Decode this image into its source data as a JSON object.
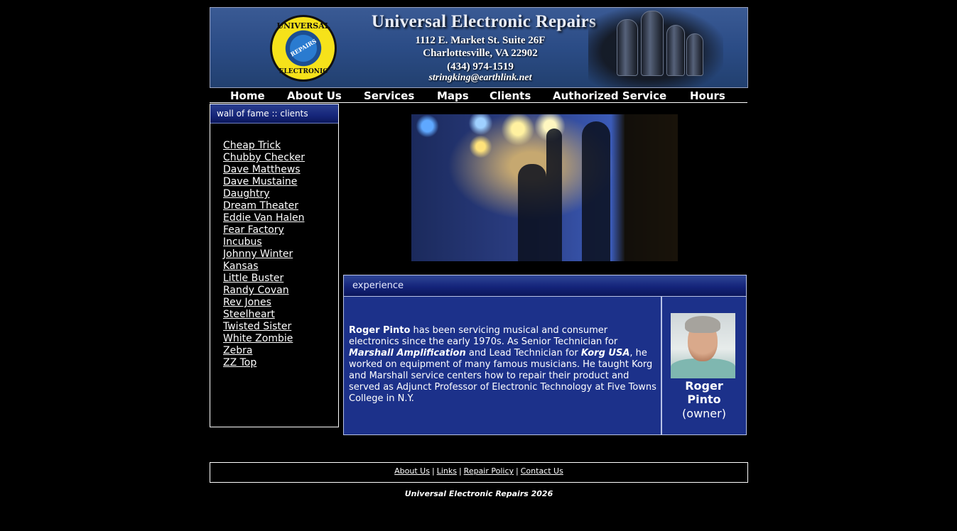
{
  "header": {
    "company_name": "Universal Electronic Repairs",
    "address_line1": "1112 E. Market St. Suite 26F",
    "address_line2": "Charlottesville, VA  22902",
    "phone": "(434) 974-1519",
    "email": "stringking@earthlink.net",
    "logo_text_top": "UNIVERSAL",
    "logo_text_mid": "REPAIRS",
    "logo_text_bottom": "ELECTRONIC"
  },
  "nav": {
    "items": [
      {
        "label": "Home"
      },
      {
        "label": "About Us"
      },
      {
        "label": "Services"
      },
      {
        "label": "Maps"
      },
      {
        "label": "Clients"
      },
      {
        "label": "Authorized Service"
      },
      {
        "label": "Hours"
      }
    ]
  },
  "sidebar": {
    "title": "wall of fame :: clients",
    "clients": [
      "Cheap Trick",
      "Chubby Checker",
      "Dave Matthews",
      "Dave Mustaine",
      "Daughtry",
      "Dream Theater",
      "Eddie Van Halen",
      "Fear Factory",
      "Incubus",
      "Johnny Winter",
      "Kansas",
      "Little Buster",
      "Randy Covan",
      "Rev Jones",
      "Steelheart",
      "Twisted Sister",
      "White Zombie",
      "Zebra",
      "ZZ Top"
    ]
  },
  "experience": {
    "title": "experience",
    "name_bold": "Roger Pinto",
    "text_part1": " has been servicing musical and consumer electronics since the early 1970s.  As Senior Technician for ",
    "company1": "Marshall Amplification",
    "text_part2": " and Lead Technician for ",
    "company2": "Korg USA",
    "text_part3": ", he worked on equipment of many famous musicians.  He taught Korg and Marshall service centers how to repair their product and served as Adjunct Professor of Electronic Technology at Five Towns College in N.Y.",
    "owner_first": "Roger",
    "owner_last": "Pinto",
    "owner_role": "(owner)"
  },
  "footer": {
    "links": [
      "About Us",
      "Links",
      "Repair Policy",
      "Contact Us"
    ],
    "separator": "|",
    "copyright": "Universal Electronic Repairs 2026"
  }
}
